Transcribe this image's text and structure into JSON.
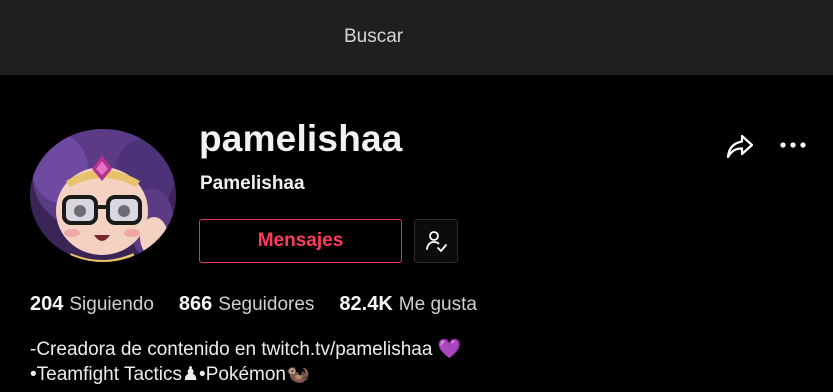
{
  "topbar": {
    "search_label": "Buscar"
  },
  "profile": {
    "username": "pamelishaa",
    "display_name": "Pamelishaa",
    "message_button_label": "Mensajes",
    "avatar_icon": "avatar-illustration"
  },
  "actions": {
    "share_icon": "share-arrow-icon",
    "more_icon": "more-horizontal-icon",
    "following_icon": "user-check-icon"
  },
  "stats": {
    "following_count": "204",
    "following_label": "Siguiendo",
    "followers_count": "866",
    "followers_label": "Seguidores",
    "likes_count": "82.4K",
    "likes_label": "Me gusta"
  },
  "bio": {
    "line1": "-Creadora de contenido en twitch.tv/pamelishaa 💜",
    "line2": "•Teamfight Tactics♟•Pokémon🦦"
  },
  "colors": {
    "accent": "#ff3b5c",
    "topbar_bg": "#1f1f1f",
    "page_bg": "#000000"
  }
}
